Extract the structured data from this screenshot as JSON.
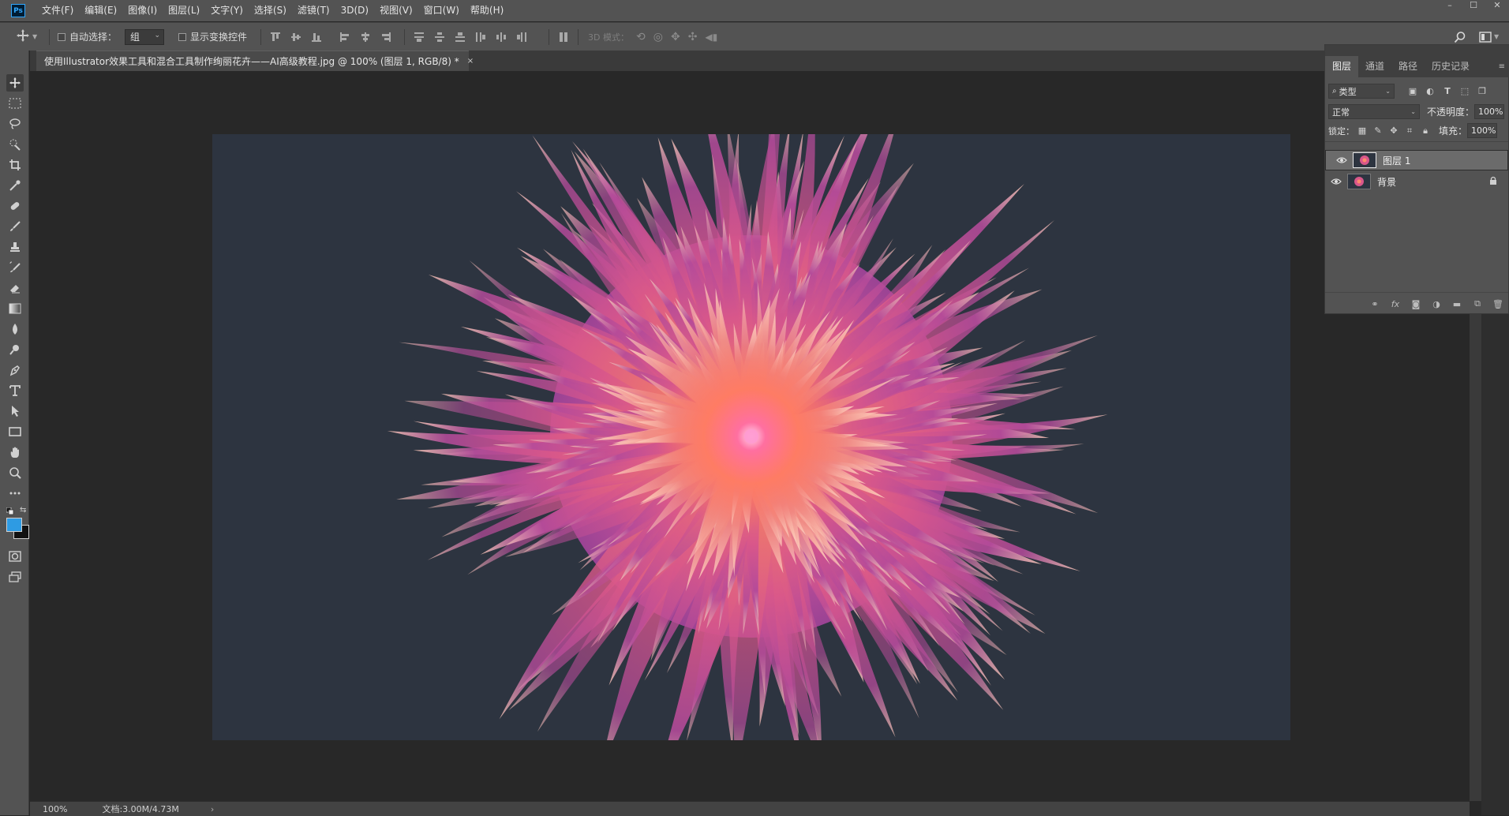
{
  "app": {
    "logo": "Ps"
  },
  "menu": [
    "文件(F)",
    "编辑(E)",
    "图像(I)",
    "图层(L)",
    "文字(Y)",
    "选择(S)",
    "滤镜(T)",
    "3D(D)",
    "视图(V)",
    "窗口(W)",
    "帮助(H)"
  ],
  "window_controls": [
    "–",
    "☐",
    "✕"
  ],
  "options": {
    "auto_select_label": "自动选择：",
    "auto_select_value": "组",
    "show_transform_label": "显示变换控件",
    "mode_3d_label": "3D 模式："
  },
  "document": {
    "tab_title": "使用Illustrator效果工具和混合工具制作绚丽花卉——AI高级教程.jpg @ 100% (图层 1, RGB/8) *",
    "close": "×"
  },
  "status": {
    "zoom": "100%",
    "doc_info": "文档:3.00M/4.73M",
    "arrow": "›"
  },
  "colors": {
    "foreground": "#2e9be3",
    "background": "#111111",
    "canvas_bg": "#2d3440",
    "ui": "#535353"
  },
  "panel": {
    "tabs": [
      "图层",
      "通道",
      "路径",
      "历史记录"
    ],
    "active_tab": "图层",
    "filter_kind": "类型",
    "blend_mode": "正常",
    "opacity_label": "不透明度：",
    "opacity_value": "100%",
    "lock_label": "锁定：",
    "fill_label": "填充：",
    "fill_value": "100%",
    "layers": [
      {
        "name": "图层 1",
        "selected": true,
        "visible": true,
        "locked": false
      },
      {
        "name": "背景",
        "selected": false,
        "visible": true,
        "locked": true
      }
    ]
  }
}
